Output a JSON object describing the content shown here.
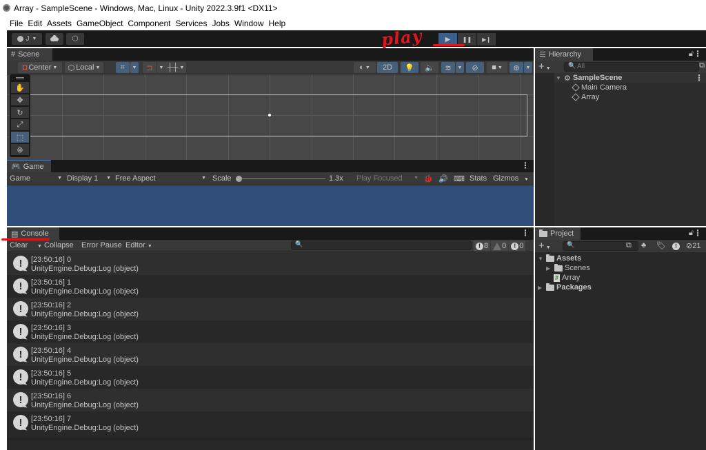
{
  "window": {
    "title": "Array - SampleScene - Windows, Mac, Linux - Unity 2022.3.9f1 <DX11>"
  },
  "menu": [
    "File",
    "Edit",
    "Assets",
    "GameObject",
    "Component",
    "Services",
    "Jobs",
    "Window",
    "Help"
  ],
  "toolbar": {
    "account_label": "J",
    "cloud_icon": "cloud-icon",
    "collab_icon": "collab-icon",
    "play_icon": "▶",
    "pause_icon": "❚❚",
    "step_icon": "▶❙",
    "play_active": true
  },
  "annotation": {
    "text": "play",
    "color": "#e0161f"
  },
  "scene": {
    "tab_label": "Scene",
    "pivot_mode": "Center",
    "pivot_rotation": "Local",
    "toggle_2d": "2D",
    "tools": [
      "hand",
      "move",
      "rotate",
      "scale",
      "rect",
      "transform"
    ],
    "selected_tool": "rect"
  },
  "game": {
    "tab_label": "Game",
    "view_mode": "Game",
    "display": "Display 1",
    "aspect": "Free Aspect",
    "scale_label": "Scale",
    "scale_value": "1.3x",
    "play_mode": "Play Focused",
    "stats": "Stats",
    "gizmos": "Gizmos",
    "background_color": "#314d79"
  },
  "console": {
    "tab_label": "Console",
    "clear": "Clear",
    "collapse": "Collapse",
    "error_pause": "Error Pause",
    "editor": "Editor",
    "search_placeholder": "",
    "log_count": "8",
    "warning_count": "0",
    "error_count": "0",
    "entries": [
      {
        "line1": "[23:50:16] 0",
        "line2": "UnityEngine.Debug:Log (object)"
      },
      {
        "line1": "[23:50:16] 1",
        "line2": "UnityEngine.Debug:Log (object)"
      },
      {
        "line1": "[23:50:16] 2",
        "line2": "UnityEngine.Debug:Log (object)"
      },
      {
        "line1": "[23:50:16] 3",
        "line2": "UnityEngine.Debug:Log (object)"
      },
      {
        "line1": "[23:50:16] 4",
        "line2": "UnityEngine.Debug:Log (object)"
      },
      {
        "line1": "[23:50:16] 5",
        "line2": "UnityEngine.Debug:Log (object)"
      },
      {
        "line1": "[23:50:16] 6",
        "line2": "UnityEngine.Debug:Log (object)"
      },
      {
        "line1": "[23:50:16] 7",
        "line2": "UnityEngine.Debug:Log (object)"
      }
    ]
  },
  "hierarchy": {
    "tab_label": "Hierarchy",
    "search_placeholder": "All",
    "scene_name": "SampleScene",
    "objects": [
      "Main Camera",
      "Array"
    ]
  },
  "project": {
    "tab_label": "Project",
    "hidden_count": "21",
    "tree": {
      "assets": "Assets",
      "scenes": "Scenes",
      "script": "Array",
      "packages": "Packages"
    }
  }
}
